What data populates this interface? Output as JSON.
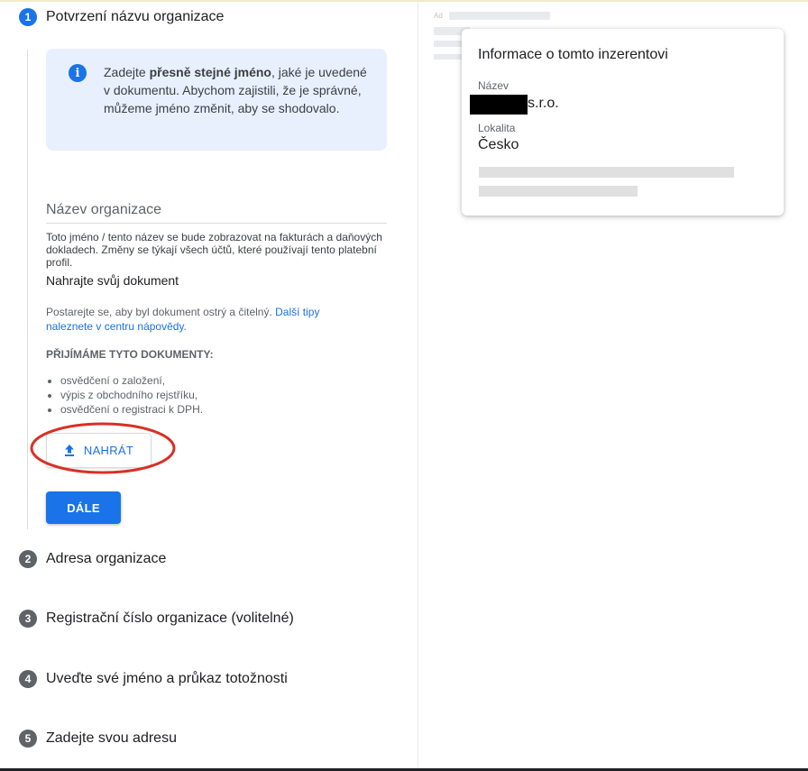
{
  "steps": [
    {
      "number": "1",
      "title": "Potvrzení názvu organizace"
    },
    {
      "number": "2",
      "title": "Adresa organizace"
    },
    {
      "number": "3",
      "title": "Registrační číslo organizace (volitelné)"
    },
    {
      "number": "4",
      "title": "Uveďte své jméno a průkaz totožnosti"
    },
    {
      "number": "5",
      "title": "Zadejte svou adresu"
    }
  ],
  "info": {
    "icon": "info-icon",
    "text_before": "Zadejte ",
    "text_bold": "přesně stejné jméno",
    "text_after": ", jaké je uvedené v dokumentu. Abychom zajistili, že je správné, můžeme jméno změnit, aby se shodovalo."
  },
  "org_name_field": {
    "label": "Název organizace",
    "help": "Toto jméno / tento název se bude zobrazovat na fakturách a daňových dokladech. Změny se týkají všech účtů, které používají tento platební profil."
  },
  "upload": {
    "heading": "Nahrajte svůj dokument",
    "tip": "Postarejte se, aby byl dokument ostrý a čitelný. ",
    "tip_link": "Další tipy naleznete v centru nápovědy.",
    "accepted_heading": "PŘIJÍMÁME TYTO DOKUMENTY:",
    "documents": [
      "osvědčení o založení,",
      "výpis z obchodního rejstříku,",
      "osvědčení o registraci k DPH."
    ],
    "button_label": "NAHRÁT",
    "annotation_color": "#d93025"
  },
  "next_button_label": "DÁLE",
  "advertiser_card": {
    "ad_tag": "Ad",
    "title": "Informace o tomto inzerentovi",
    "name_label": "Název",
    "name_value": "s.r.o.",
    "location_label": "Lokalita",
    "location_value": "Česko"
  },
  "colors": {
    "accent": "#1a73e8",
    "info_bg": "#e8f0fe",
    "step_inactive": "#5f6368"
  }
}
